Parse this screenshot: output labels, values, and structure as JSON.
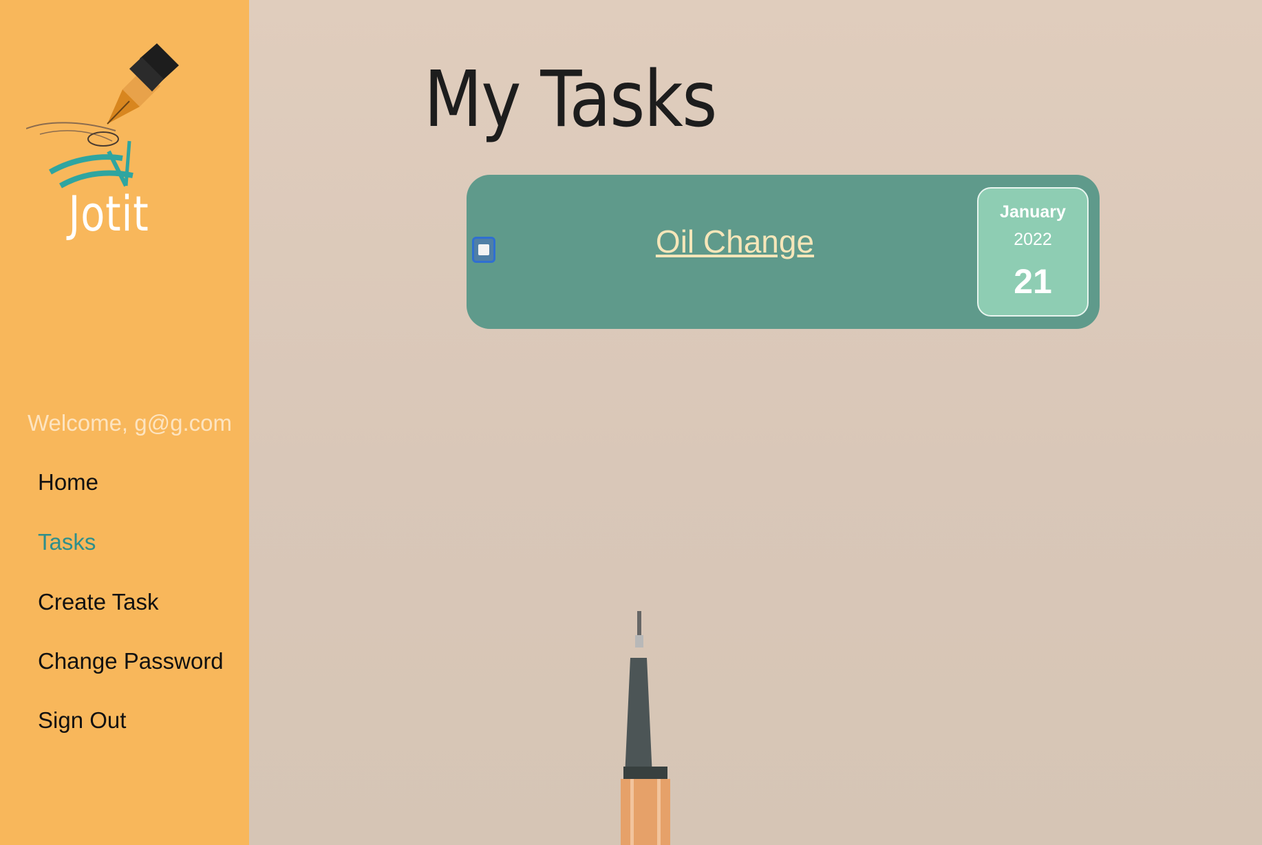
{
  "sidebar": {
    "logo_text": "Jotit",
    "welcome": "Welcome, g@g.com",
    "nav": [
      {
        "label": "Home",
        "active": false
      },
      {
        "label": "Tasks",
        "active": true
      },
      {
        "label": "Create Task",
        "active": false
      },
      {
        "label": "Change Password",
        "active": false
      },
      {
        "label": "Sign Out",
        "active": false
      }
    ]
  },
  "main": {
    "title": "My Tasks",
    "tasks": [
      {
        "title": "Oil Change",
        "checked": false,
        "date": {
          "month": "January",
          "year": "2022",
          "day": "21"
        }
      }
    ]
  },
  "colors": {
    "sidebar": "#f8b75b",
    "active_nav": "#2f8f8b",
    "task_card": "#5f9a8b",
    "date_box": "#8ecdb3",
    "task_title": "#f6e6b9"
  },
  "icons": {
    "logo": "fountain-pen-logo-icon",
    "checkbox": "checkbox-icon",
    "background": "pen-illustration"
  }
}
